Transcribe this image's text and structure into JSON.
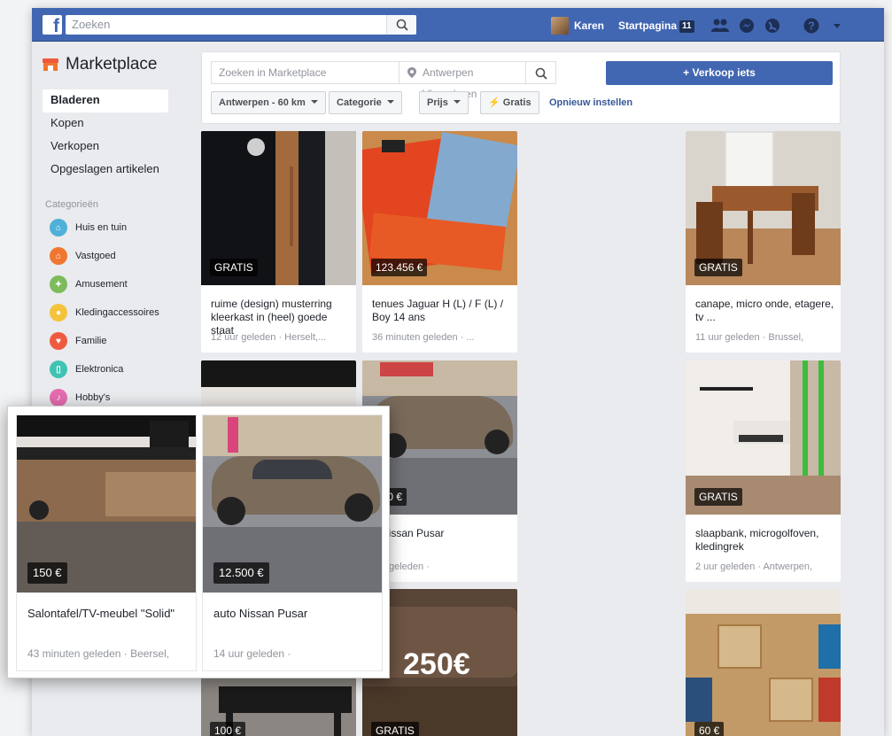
{
  "topbar": {
    "logo": "f",
    "search_placeholder": "Zoeken",
    "profile_name": "Karen",
    "home_label": "Startpagina",
    "home_badge": "11",
    "icons": [
      "friends-icon",
      "messenger-icon",
      "globe-icon",
      "help-icon",
      "dropdown-icon"
    ]
  },
  "sidebar": {
    "title": "Marketplace",
    "nav": [
      "Bladeren",
      "Kopen",
      "Verkopen",
      "Opgeslagen artikelen"
    ],
    "categories_heading": "Categorieën",
    "categories": [
      {
        "label": "Huis en tuin",
        "color": "#4fb0d9"
      },
      {
        "label": "Vastgoed",
        "color": "#f0762f"
      },
      {
        "label": "Amusement",
        "color": "#7dbb5b"
      },
      {
        "label": "Kledingaccessoires",
        "color": "#f5c33b"
      },
      {
        "label": "Familie",
        "color": "#ef5a3f"
      },
      {
        "label": "Elektronica",
        "color": "#3fc3b3"
      },
      {
        "label": "Hobby's",
        "color": "#e66cb0"
      }
    ]
  },
  "filter": {
    "search_placeholder": "Zoeken in Marketplace",
    "location_placeholder": "Antwerpen Vlaanderen",
    "sell_label": "+ Verkoop iets",
    "chips": [
      "Antwerpen - 60 km",
      "Categorie",
      "Prijs",
      "Gratis"
    ],
    "reset_label": "Opnieuw instellen"
  },
  "listings": [
    {
      "price": "GRATIS",
      "title": "ruime (design) musterring kleerkast in (heel) goede staat",
      "meta": "12 uur geleden · Herselt,..."
    },
    {
      "price": "123.456 €",
      "title": "tenues Jaguar H (L) / F (L) / Boy 14 ans",
      "meta": "36 minuten geleden · ..."
    },
    {
      "price": "GRATIS",
      "title": "canape, micro onde, etagere, tv ...",
      "meta": "11 uur geleden · Brussel,"
    },
    {
      "price": "500 €",
      "title": "o Nissan Pusar",
      "meta": "uur geleden ·"
    },
    {
      "price": "GRATIS",
      "title": "slaapbank, microgolfoven, kledingrek",
      "meta": "2 uur geleden · Antwerpen,"
    },
    {
      "price": "100 €",
      "title": "",
      "meta": ""
    },
    {
      "price": "GRATIS",
      "overlay_price": "250€",
      "title": "",
      "meta": ""
    },
    {
      "price": "60 €",
      "title": "",
      "meta": ""
    }
  ],
  "zoom": [
    {
      "price": "150 €",
      "title": "Salontafel/TV-meubel \"Solid\"",
      "meta": "43 minuten geleden · Beersel,"
    },
    {
      "price": "12.500 €",
      "title": "auto Nissan Pusar",
      "meta": "14 uur geleden ·"
    }
  ]
}
